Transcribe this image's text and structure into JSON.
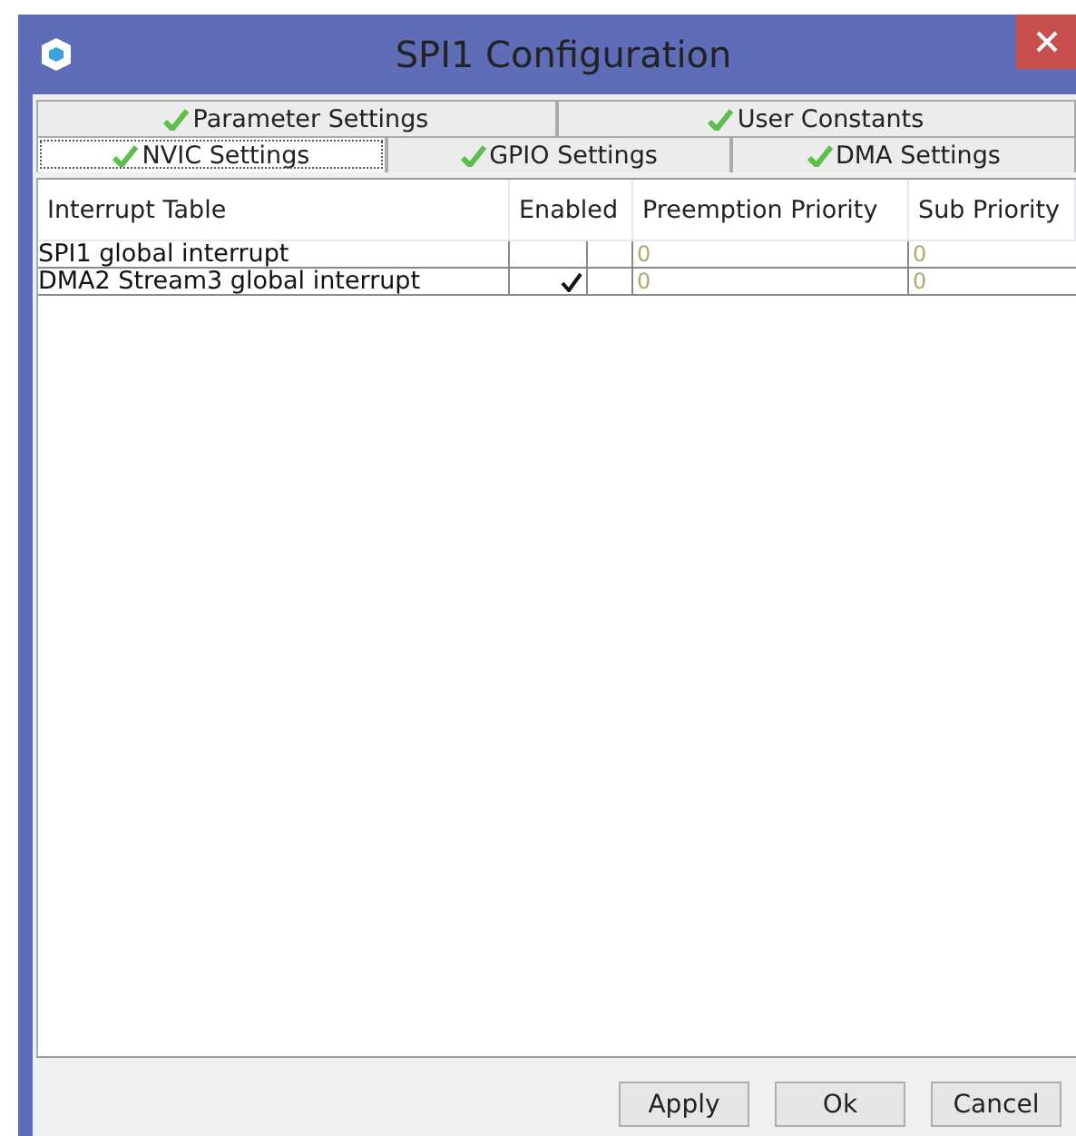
{
  "window": {
    "title": "SPI1 Configuration"
  },
  "tab_rows": [
    [
      {
        "label": "Parameter Settings",
        "selected": false
      },
      {
        "label": "User Constants",
        "selected": false
      }
    ],
    [
      {
        "label": "NVIC Settings",
        "selected": true
      },
      {
        "label": "GPIO Settings",
        "selected": false
      },
      {
        "label": "DMA Settings",
        "selected": false
      }
    ]
  ],
  "table": {
    "columns": [
      "Interrupt Table",
      "Enabled",
      "Preemption Priority",
      "Sub Priority"
    ],
    "rows": [
      {
        "name": "SPI1 global interrupt",
        "enabled": false,
        "preemption": "0",
        "sub": "0"
      },
      {
        "name": "DMA2 Stream3 global interrupt",
        "enabled": true,
        "preemption": "0",
        "sub": "0"
      }
    ]
  },
  "buttons": [
    "Apply",
    "Ok",
    "Cancel"
  ]
}
